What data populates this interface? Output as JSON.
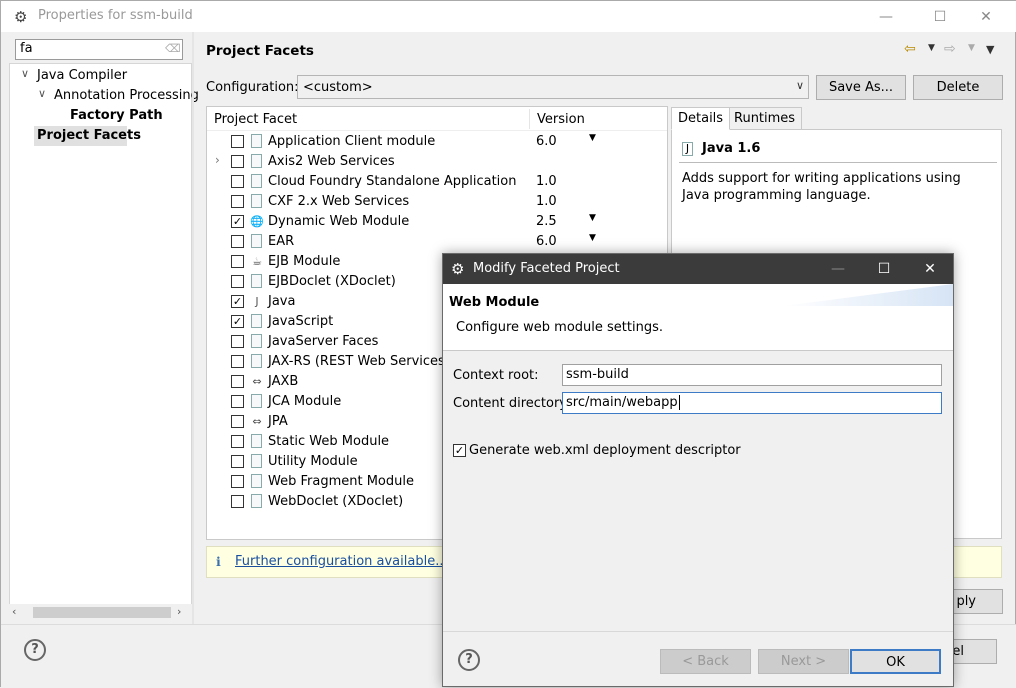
{
  "window": {
    "title": "Properties for ssm-build"
  },
  "filter": {
    "value": "fa"
  },
  "tree": {
    "java_compiler": "Java Compiler",
    "annotation_processing": "Annotation Processing",
    "factory_path": "Factory Path",
    "project_facets": "Project Facets"
  },
  "page": {
    "title": "Project Facets"
  },
  "configuration": {
    "label": "Configuration:",
    "value": "<custom>",
    "save_as": "Save As...",
    "delete": "Delete"
  },
  "facets": {
    "col_facet": "Project Facet",
    "col_version": "Version",
    "rows": [
      {
        "name": "Application Client module",
        "version": "6.0",
        "checked": false,
        "dd": true
      },
      {
        "name": "Axis2 Web Services",
        "version": "",
        "checked": false,
        "dd": false
      },
      {
        "name": "Cloud Foundry Standalone Application",
        "version": "1.0",
        "checked": false,
        "dd": false
      },
      {
        "name": "CXF 2.x Web Services",
        "version": "1.0",
        "checked": false,
        "dd": false
      },
      {
        "name": "Dynamic Web Module",
        "version": "2.5",
        "checked": true,
        "dd": true
      },
      {
        "name": "EAR",
        "version": "6.0",
        "checked": false,
        "dd": true
      },
      {
        "name": "EJB Module",
        "version": "",
        "checked": false,
        "dd": false
      },
      {
        "name": "EJBDoclet (XDoclet)",
        "version": "",
        "checked": false,
        "dd": false
      },
      {
        "name": "Java",
        "version": "",
        "checked": true,
        "dd": false
      },
      {
        "name": "JavaScript",
        "version": "",
        "checked": true,
        "dd": false
      },
      {
        "name": "JavaServer Faces",
        "version": "",
        "checked": false,
        "dd": false
      },
      {
        "name": "JAX-RS (REST Web Services)",
        "version": "",
        "checked": false,
        "dd": false
      },
      {
        "name": "JAXB",
        "version": "",
        "checked": false,
        "dd": false
      },
      {
        "name": "JCA Module",
        "version": "",
        "checked": false,
        "dd": false
      },
      {
        "name": "JPA",
        "version": "",
        "checked": false,
        "dd": false
      },
      {
        "name": "Static Web Module",
        "version": "",
        "checked": false,
        "dd": false
      },
      {
        "name": "Utility Module",
        "version": "",
        "checked": false,
        "dd": false
      },
      {
        "name": "Web Fragment Module",
        "version": "",
        "checked": false,
        "dd": false
      },
      {
        "name": "WebDoclet (XDoclet)",
        "version": "",
        "checked": false,
        "dd": false
      }
    ]
  },
  "details": {
    "tab_details": "Details",
    "tab_runtimes": "Runtimes",
    "heading": "Java 1.6",
    "description": "Adds support for writing applications using Java programming language."
  },
  "info": {
    "link": "Further configuration available..."
  },
  "bottom": {
    "apply_partial": "ply",
    "cancel_partial": "el"
  },
  "dialog": {
    "title": "Modify Faceted Project",
    "heading": "Web Module",
    "subtitle": "Configure web module settings.",
    "context_root_label": "Context root:",
    "context_root_value": "ssm-build",
    "content_dir_label": "Content directory:",
    "content_dir_value": "src/main/webapp",
    "generate_label": "Generate web.xml deployment descriptor",
    "back": "< Back",
    "next": "Next >",
    "ok": "OK"
  }
}
